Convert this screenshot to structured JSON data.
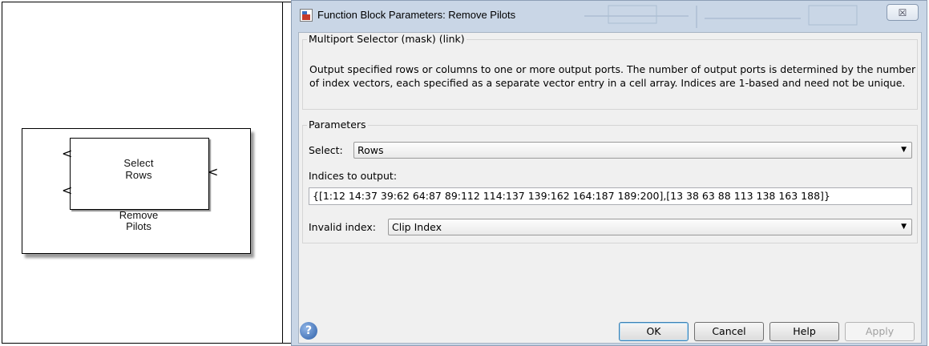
{
  "simulink": {
    "block_label": "Select\nRows",
    "block_name": "Remove\nPilots",
    "port_glyph": "<"
  },
  "dialog": {
    "title": "Function Block Parameters: Remove Pilots",
    "close_glyph": "☒",
    "mask_group_title": "Multiport Selector (mask) (link)",
    "description": "Output specified rows or columns to one or more output ports.  The number of output ports is determined by the number of index vectors, each specified as a separate vector entry in a cell array.  Indices are 1-based and need not be unique.",
    "params_group_title": "Parameters",
    "select_label": "Select:",
    "select_value": "Rows",
    "indices_label": "Indices to output:",
    "indices_value": "{[1:12 14:37 39:62 64:87 89:112 114:137 139:162 164:187 189:200],[13 38 63 88 113 138 163 188]}",
    "invalid_label": "Invalid index:",
    "invalid_value": "Clip Index",
    "dropdown_arrow": "▼",
    "help_icon_glyph": "?",
    "buttons": {
      "ok": "OK",
      "cancel": "Cancel",
      "help": "Help",
      "apply": "Apply"
    }
  }
}
